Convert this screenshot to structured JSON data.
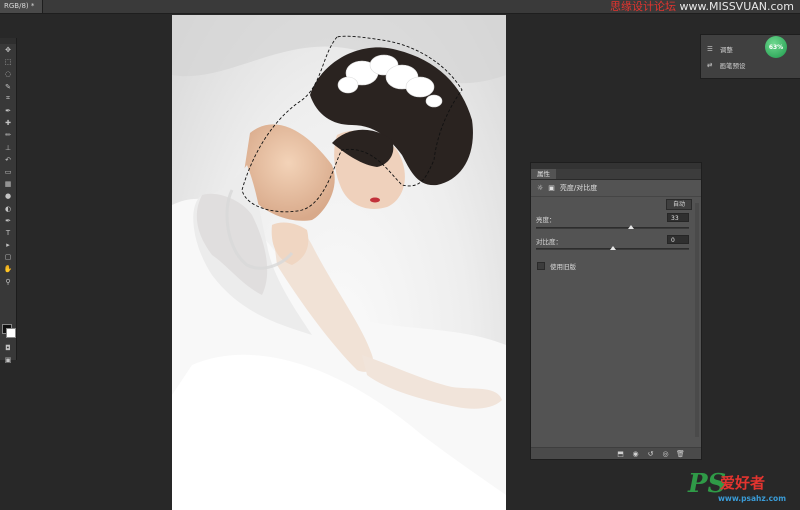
{
  "document": {
    "tab_title": "RGB/8) *"
  },
  "watermark": {
    "prefix": "思缘设计论坛",
    "site": "www.MISSVUAN.com"
  },
  "toolbar": {
    "tools": [
      "move-icon",
      "marquee-icon",
      "lasso-icon",
      "quick-select-icon",
      "crop-icon",
      "eyedropper-icon",
      "healing-icon",
      "brush-icon",
      "stamp-icon",
      "history-brush-icon",
      "eraser-icon",
      "gradient-icon",
      "blur-icon",
      "dodge-icon",
      "pen-icon",
      "type-icon",
      "path-select-icon",
      "shape-icon",
      "hand-icon",
      "zoom-icon"
    ]
  },
  "adjust_panel": {
    "item1": "调整",
    "item2": "画笔预设",
    "nav_percent": "63%"
  },
  "properties": {
    "tab": "属性",
    "title": "亮度/对比度",
    "auto_label": "自动",
    "brightness_label": "亮度：",
    "brightness_value": "33",
    "brightness_slider": 0.62,
    "contrast_label": "对比度：",
    "contrast_value": "0",
    "contrast_slider": 0.5,
    "legacy_label": "使用旧版"
  },
  "logo": {
    "ps": "PS",
    "cn": "爱好者",
    "url": "www.psahz.com"
  },
  "colors": {
    "accent_green": "#2f9a47",
    "accent_red": "#e3342f",
    "panel": "#535353"
  }
}
